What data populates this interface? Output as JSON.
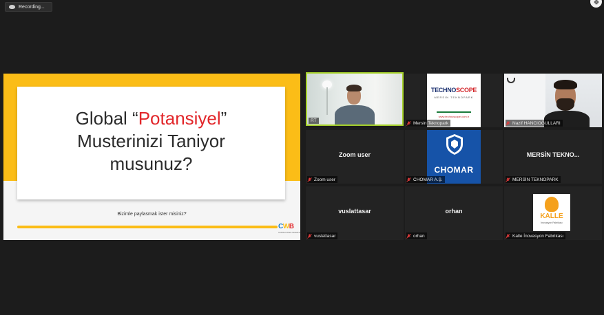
{
  "recording": {
    "label": "Recording..."
  },
  "slide": {
    "title_prefix": "Global “",
    "title_highlight": "Potansiyel",
    "title_suffix": "”",
    "title_line2": "Musterinizi Taniyor",
    "title_line3": "musunuz?",
    "subtitle": "Bizimle paylasmak ister misiniz?",
    "logo_c": "C",
    "logo_w": "W",
    "logo_b": "B",
    "logo_small": "CONSULTING WORKS",
    "accent_color": "#fbbd17",
    "highlight_color": "#e2262a"
  },
  "participants": [
    {
      "id": "rt",
      "label": "RT",
      "muted": false,
      "active_speaker": true
    },
    {
      "id": "mersin-tekno",
      "label": "Mersin Teknopark",
      "logo_title_a": "TECHNO",
      "logo_title_b": "SCOPE",
      "logo_sub": "MERSIN TEKNOPARK",
      "logo_url": "www.technoscope.com.tr",
      "muted": true
    },
    {
      "id": "nazif",
      "label": "Nazif HANCIOĞULLARI",
      "muted": true
    },
    {
      "id": "zoom-user",
      "label": "Zoom user",
      "display_name": "Zoom user",
      "muted": true
    },
    {
      "id": "chomar",
      "label": "CHOMAR A.Ş.",
      "logo_text": "CHOMAR",
      "muted": true
    },
    {
      "id": "mersin-teknopark",
      "label": "MERSİN TEKNOPARK",
      "display_name": "MERSİN TEKNO...",
      "muted": true
    },
    {
      "id": "vuslattasar",
      "label": "vuslattasar",
      "display_name": "vuslattasar",
      "muted": true
    },
    {
      "id": "orhan",
      "label": "orhan",
      "display_name": "orhan",
      "muted": true
    },
    {
      "id": "kalle",
      "label": "Kalle İnovasyon Fabrikası",
      "logo_text": "KALLE",
      "logo_sub": "İnovasyon Fabrikası",
      "muted": true
    }
  ],
  "icons": {
    "recording": "cloud-record-icon",
    "mic_off": "mic-off-icon",
    "fullscreen": "exit-fullscreen-icon"
  }
}
